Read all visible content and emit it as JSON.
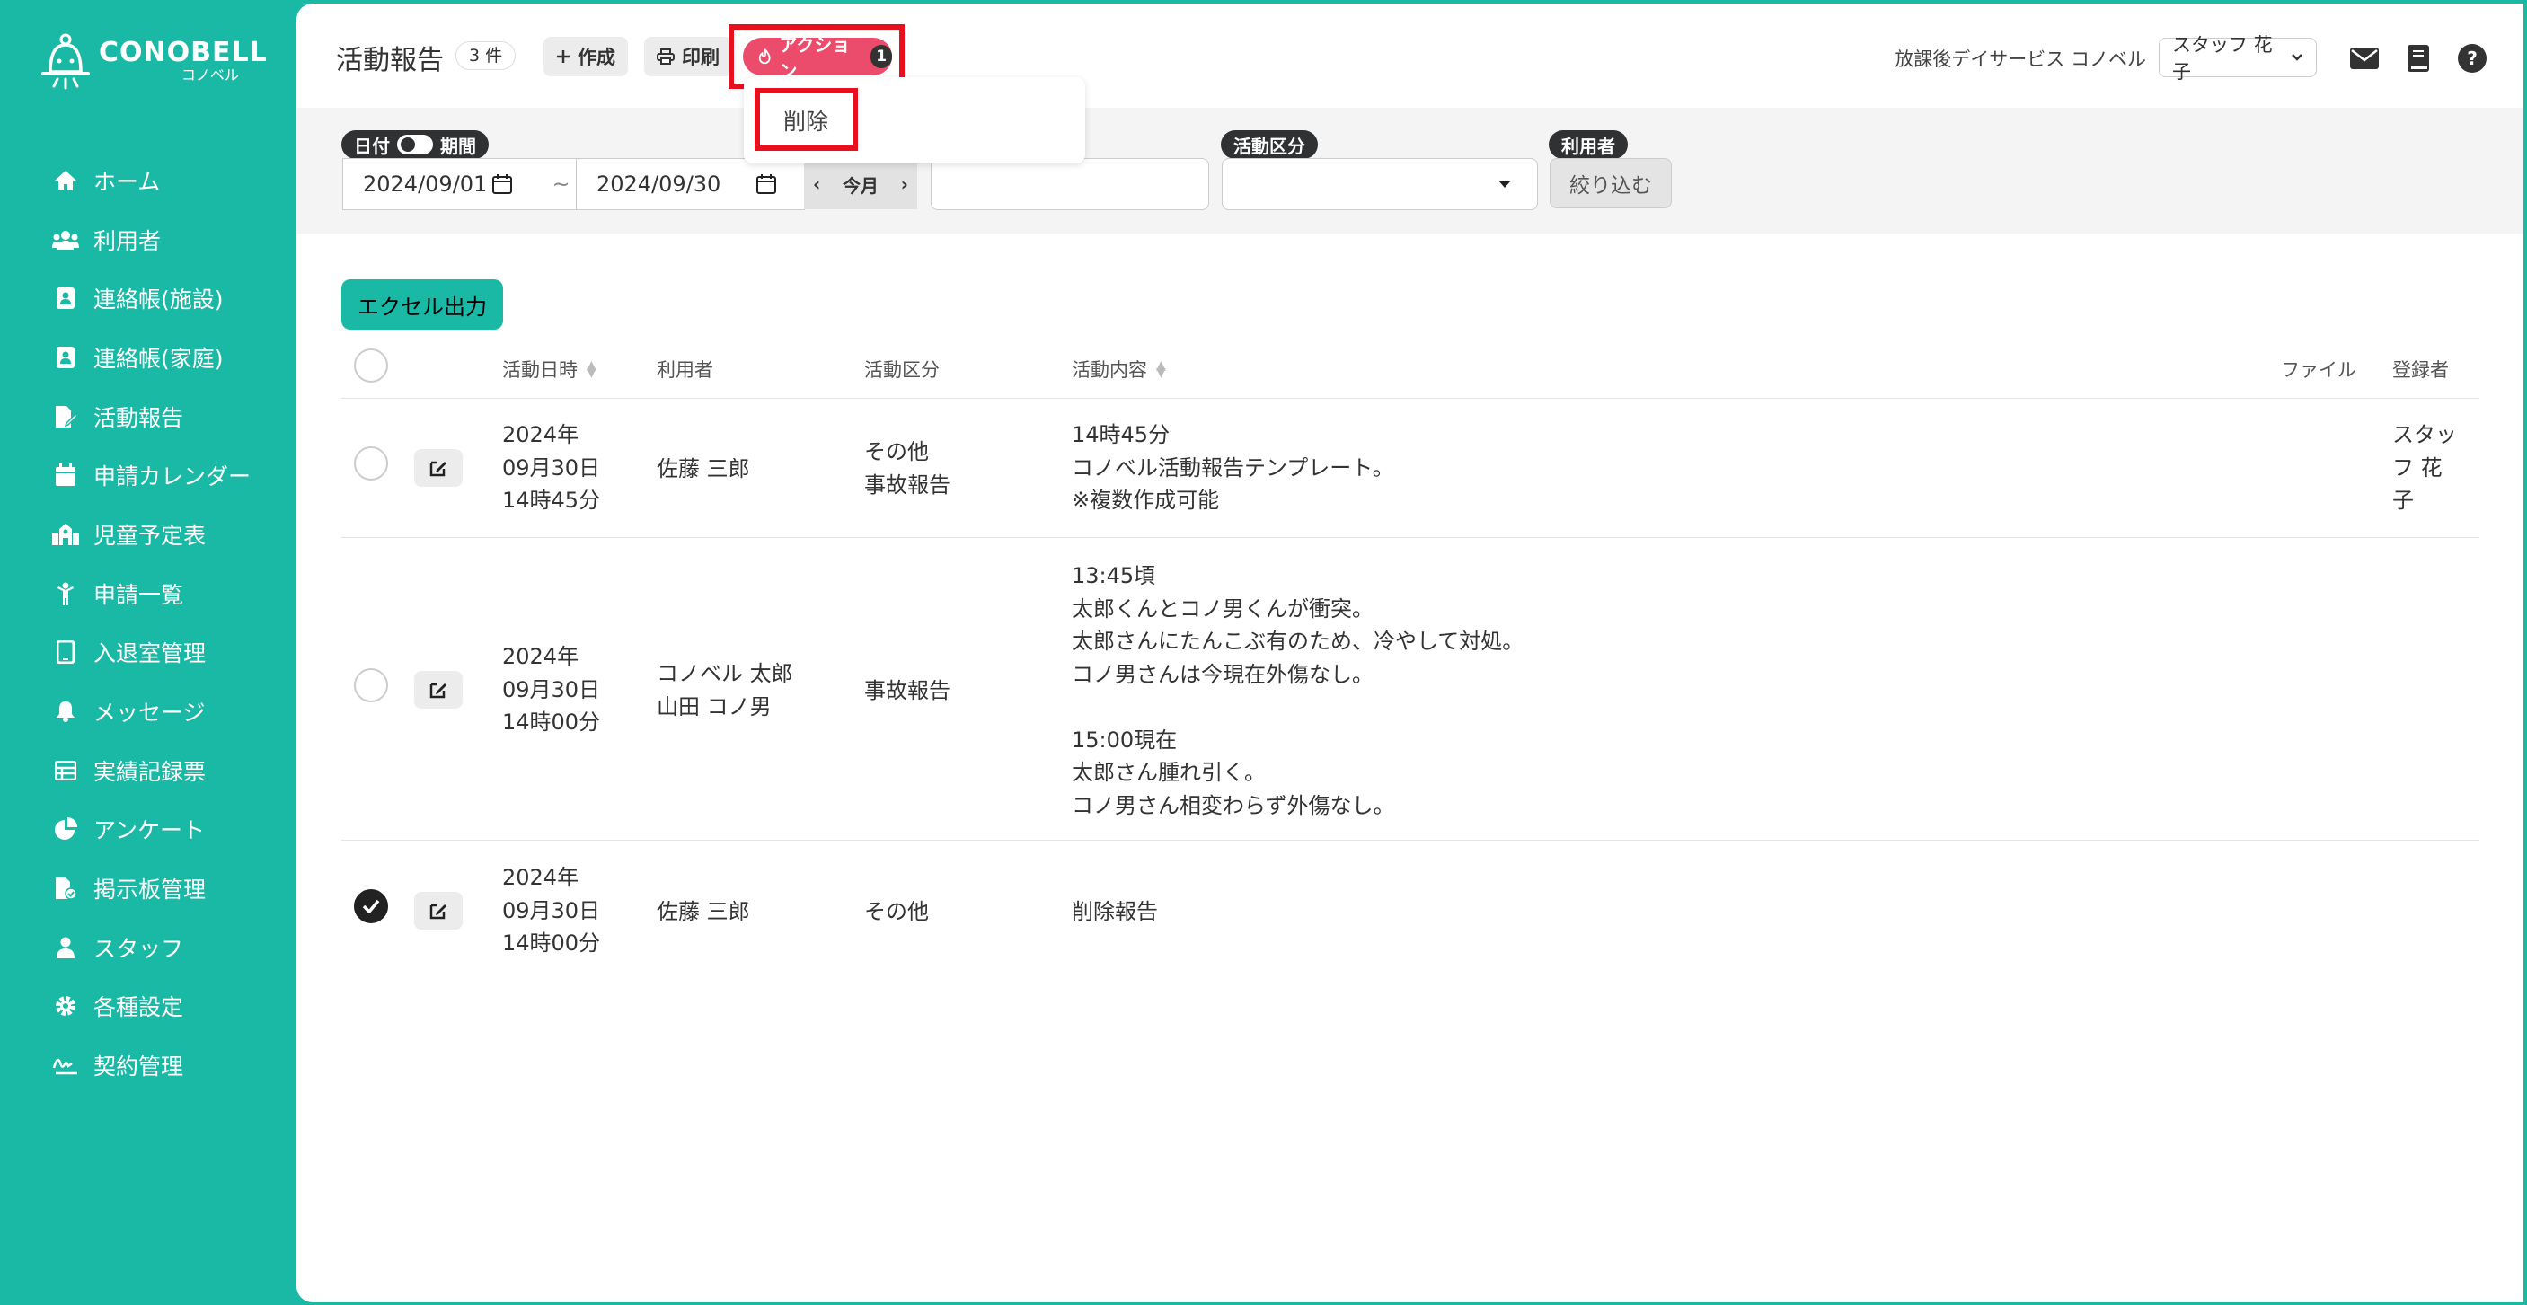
{
  "logo": {
    "name": "CONOBELL",
    "sub": "コノベル"
  },
  "sidebar": {
    "items": [
      {
        "label": "ホーム",
        "icon": "home-icon"
      },
      {
        "label": "利用者",
        "icon": "users-icon"
      },
      {
        "label": "連絡帳(施設)",
        "icon": "contact-book-icon"
      },
      {
        "label": "連絡帳(家庭)",
        "icon": "contact-book-icon"
      },
      {
        "label": "活動報告",
        "icon": "report-edit-icon"
      },
      {
        "label": "申請カレンダー",
        "icon": "calendar-icon"
      },
      {
        "label": "児童予定表",
        "icon": "school-icon"
      },
      {
        "label": "申請一覧",
        "icon": "child-icon"
      },
      {
        "label": "入退室管理",
        "icon": "tablet-icon"
      },
      {
        "label": "メッセージ",
        "icon": "bell-icon"
      },
      {
        "label": "実績記録票",
        "icon": "table-icon"
      },
      {
        "label": "アンケート",
        "icon": "pie-chart-icon"
      },
      {
        "label": "掲示板管理",
        "icon": "file-check-icon"
      },
      {
        "label": "スタッフ",
        "icon": "staff-icon"
      },
      {
        "label": "各種設定",
        "icon": "gear-icon"
      },
      {
        "label": "契約管理",
        "icon": "signature-icon"
      }
    ]
  },
  "header": {
    "title": "活動報告",
    "count": "3 件",
    "create_label": "作成",
    "print_label": "印刷",
    "action_label": "アクション",
    "action_count": "1",
    "dropdown_delete": "削除",
    "facility": "放課後デイサービス コノベル",
    "staff_name": "スタッフ 花子"
  },
  "filter": {
    "date_tag": "日付",
    "period_tag": "期間",
    "date_from": "2024/09/01",
    "tilde": "~",
    "date_to": "2024/09/30",
    "this_month": "今月",
    "category_tag": "活動区分",
    "user_tag": "利用者",
    "filter_button": "絞り込む"
  },
  "excel_button": "エクセル出力",
  "table": {
    "headers": {
      "datetime": "活動日時",
      "user": "利用者",
      "category": "活動区分",
      "content": "活動内容",
      "file": "ファイル",
      "registrant": "登録者"
    },
    "rows": [
      {
        "datetime": "2024年\n09月30日\n14時45分",
        "user": "佐藤 三郎",
        "category": "その他\n事故報告",
        "content": "14時45分\nコノベル活動報告テンプレート。\n※複数作成可能",
        "registrant": "スタッ\nフ 花\n子",
        "checked": false
      },
      {
        "datetime": "2024年\n09月30日\n14時00分",
        "user": "コノベル 太郎\n山田 コノ男",
        "category": "事故報告",
        "content": "13:45頃\n太郎くんとコノ男くんが衝突。\n太郎さんにたんこぶ有のため、冷やして対処。\nコノ男さんは今現在外傷なし。\n\n15:00現在\n太郎さん腫れ引く。\nコノ男さん相変わらず外傷なし。",
        "registrant": "",
        "checked": false
      },
      {
        "datetime": "2024年\n09月30日\n14時00分",
        "user": "佐藤 三郎",
        "category": "その他",
        "content": "削除報告",
        "registrant": "",
        "checked": true
      }
    ]
  },
  "colors": {
    "accent": "#1ab9a6",
    "action": "#ec4c6b",
    "highlight": "#e8101f"
  }
}
